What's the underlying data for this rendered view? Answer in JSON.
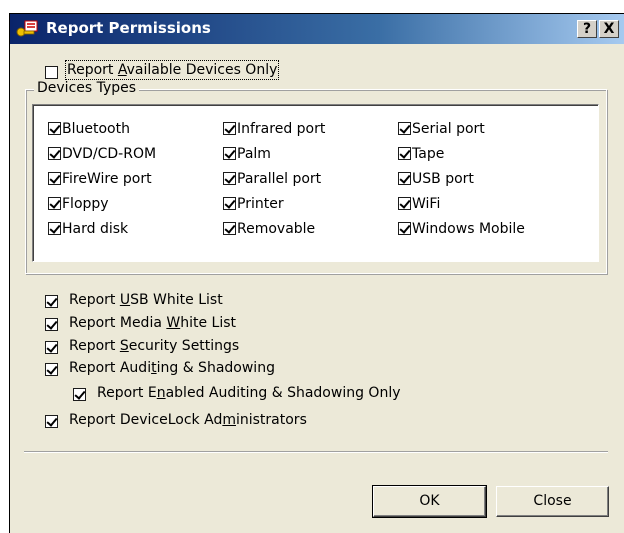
{
  "window": {
    "title": "Report Permissions",
    "help_label": "?",
    "close_label": "X"
  },
  "options": {
    "available_only": {
      "label_pre": "Report ",
      "label_key": "A",
      "label_post": "vailable Devices Only",
      "checked": false
    }
  },
  "device_types": {
    "group_label": "Devices Types",
    "columns": [
      [
        "Bluetooth",
        "DVD/CD-ROM",
        "FireWire port",
        "Floppy",
        "Hard disk"
      ],
      [
        "Infrared port",
        "Palm",
        "Parallel port",
        "Printer",
        "Removable"
      ],
      [
        "Serial port",
        "Tape",
        "USB port",
        "WiFi",
        "Windows Mobile"
      ]
    ],
    "all_checked": true
  },
  "report_options": [
    {
      "pre": "Report ",
      "key": "U",
      "post": "SB White List",
      "checked": true
    },
    {
      "pre": "Report Media ",
      "key": "W",
      "post": "hite List",
      "checked": true
    },
    {
      "pre": "Report ",
      "key": "S",
      "post": "ecurity Settings",
      "checked": true
    },
    {
      "pre": "Report Audi",
      "key": "t",
      "post": "ing & Shadowing",
      "checked": true
    },
    {
      "pre": "Report E",
      "key": "n",
      "post": "abled Auditing & Shadowing Only",
      "checked": true
    },
    {
      "pre": "Report DeviceLock Ad",
      "key": "m",
      "post": "inistrators",
      "checked": true
    }
  ],
  "buttons": {
    "ok": "OK",
    "close": "Close"
  }
}
